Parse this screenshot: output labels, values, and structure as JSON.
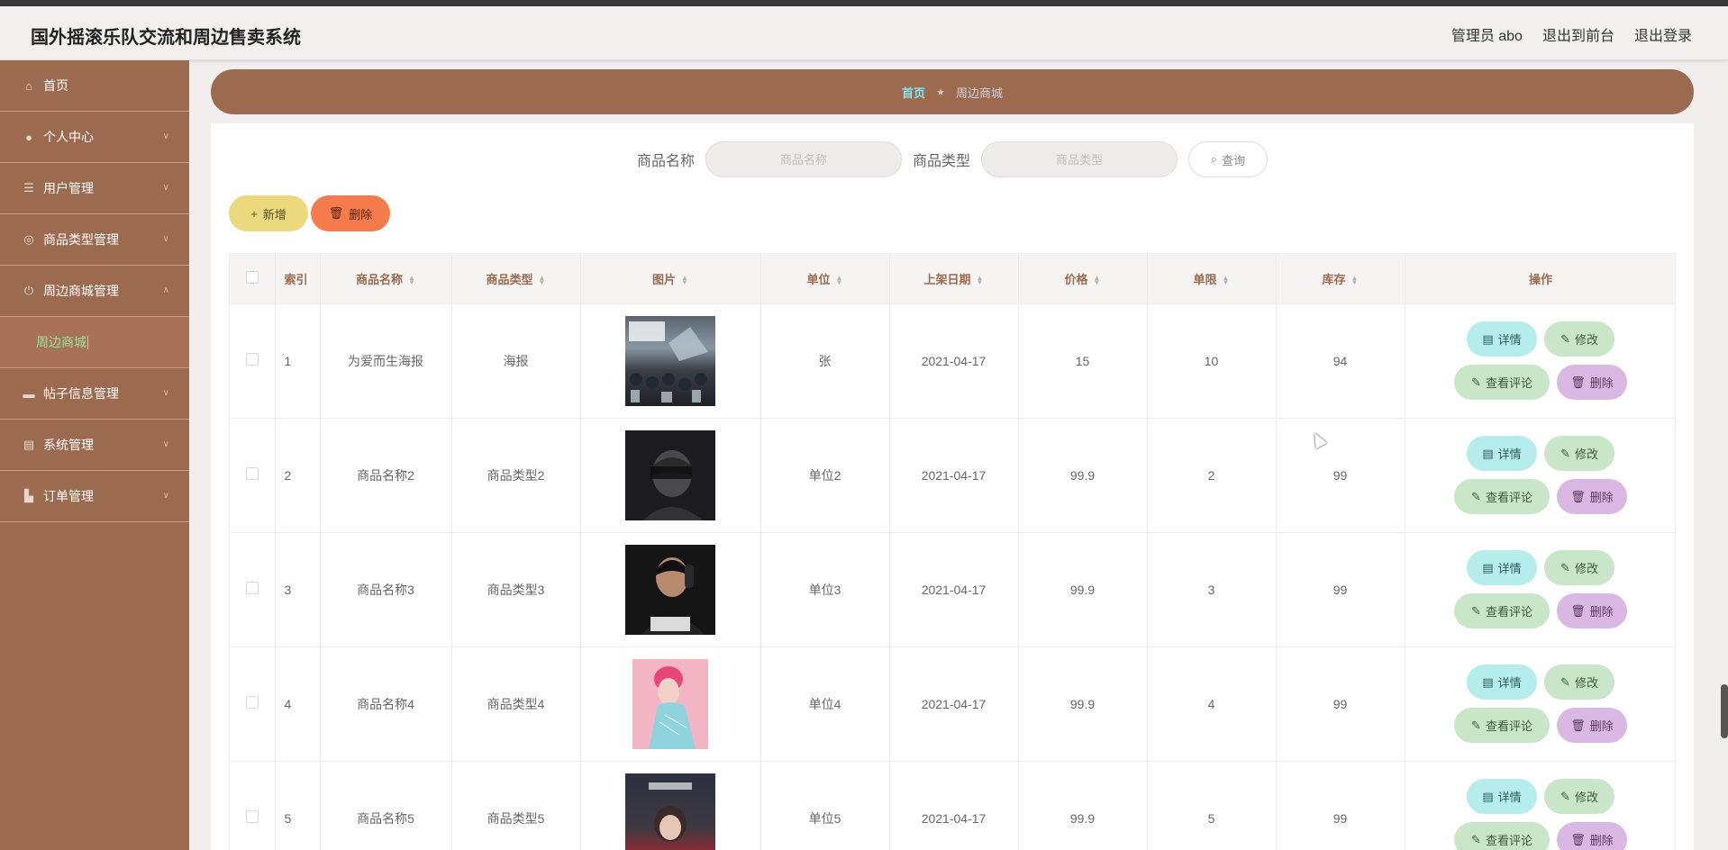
{
  "app": {
    "title": "国外摇滚乐队交流和周边售卖系统"
  },
  "header": {
    "links": [
      "管理员 abo",
      "退出到前台",
      "退出登录"
    ]
  },
  "sidebar": {
    "items": [
      {
        "label": "首页",
        "icon": "home-icon",
        "has_chevron": false
      },
      {
        "label": "个人中心",
        "icon": "user-icon",
        "has_chevron": true
      },
      {
        "label": "用户管理",
        "icon": "sliders-icon",
        "has_chevron": true
      },
      {
        "label": "商品类型管理",
        "icon": "target-icon",
        "has_chevron": true
      },
      {
        "label": "周边商城管理",
        "icon": "power-icon",
        "has_chevron": true,
        "expanded": true
      },
      {
        "label": "周边商城",
        "sub": true,
        "active": true
      },
      {
        "label": "帖子信息管理",
        "icon": "monitor-icon",
        "has_chevron": true
      },
      {
        "label": "系统管理",
        "icon": "chart-icon",
        "has_chevron": true
      },
      {
        "label": "订单管理",
        "icon": "bag-icon",
        "has_chevron": true
      }
    ]
  },
  "breadcrumb": {
    "home": "首页",
    "current": "周边商城"
  },
  "search": {
    "name_label": "商品名称",
    "name_placeholder": "商品名称",
    "type_label": "商品类型",
    "type_placeholder": "商品类型",
    "query_label": "查询"
  },
  "toolbar": {
    "add_label": "新增",
    "delete_label": "删除"
  },
  "table": {
    "headers": {
      "index": "索引",
      "name": "商品名称",
      "type": "商品类型",
      "image": "图片",
      "unit": "单位",
      "date": "上架日期",
      "price": "价格",
      "limit": "单限",
      "stock": "库存",
      "ops": "操作"
    },
    "rows": [
      {
        "index": "1",
        "name": "为爱而生海报",
        "type": "海报",
        "unit": "张",
        "date": "2021-04-17",
        "price": "15",
        "limit": "10",
        "stock": "94"
      },
      {
        "index": "2",
        "name": "商品名称2",
        "type": "商品类型2",
        "unit": "单位2",
        "date": "2021-04-17",
        "price": "99.9",
        "limit": "2",
        "stock": "99"
      },
      {
        "index": "3",
        "name": "商品名称3",
        "type": "商品类型3",
        "unit": "单位3",
        "date": "2021-04-17",
        "price": "99.9",
        "limit": "3",
        "stock": "99"
      },
      {
        "index": "4",
        "name": "商品名称4",
        "type": "商品类型4",
        "unit": "单位4",
        "date": "2021-04-17",
        "price": "99.9",
        "limit": "4",
        "stock": "99"
      },
      {
        "index": "5",
        "name": "商品名称5",
        "type": "商品类型5",
        "unit": "单位5",
        "date": "2021-04-17",
        "price": "99.9",
        "limit": "5",
        "stock": "99"
      }
    ],
    "row_actions": {
      "detail": "详情",
      "edit": "修改",
      "comment": "查看评论",
      "delete": "删除"
    }
  },
  "colors": {
    "sidebar_bg": "#9c6a4e",
    "active_sub": "#9be39b",
    "add_button": "#ecd97e",
    "delete_button": "#f57b4c",
    "detail_button": "#b5ecec",
    "edit_button": "#c9e6c9",
    "remove_button": "#d9b8e3"
  }
}
